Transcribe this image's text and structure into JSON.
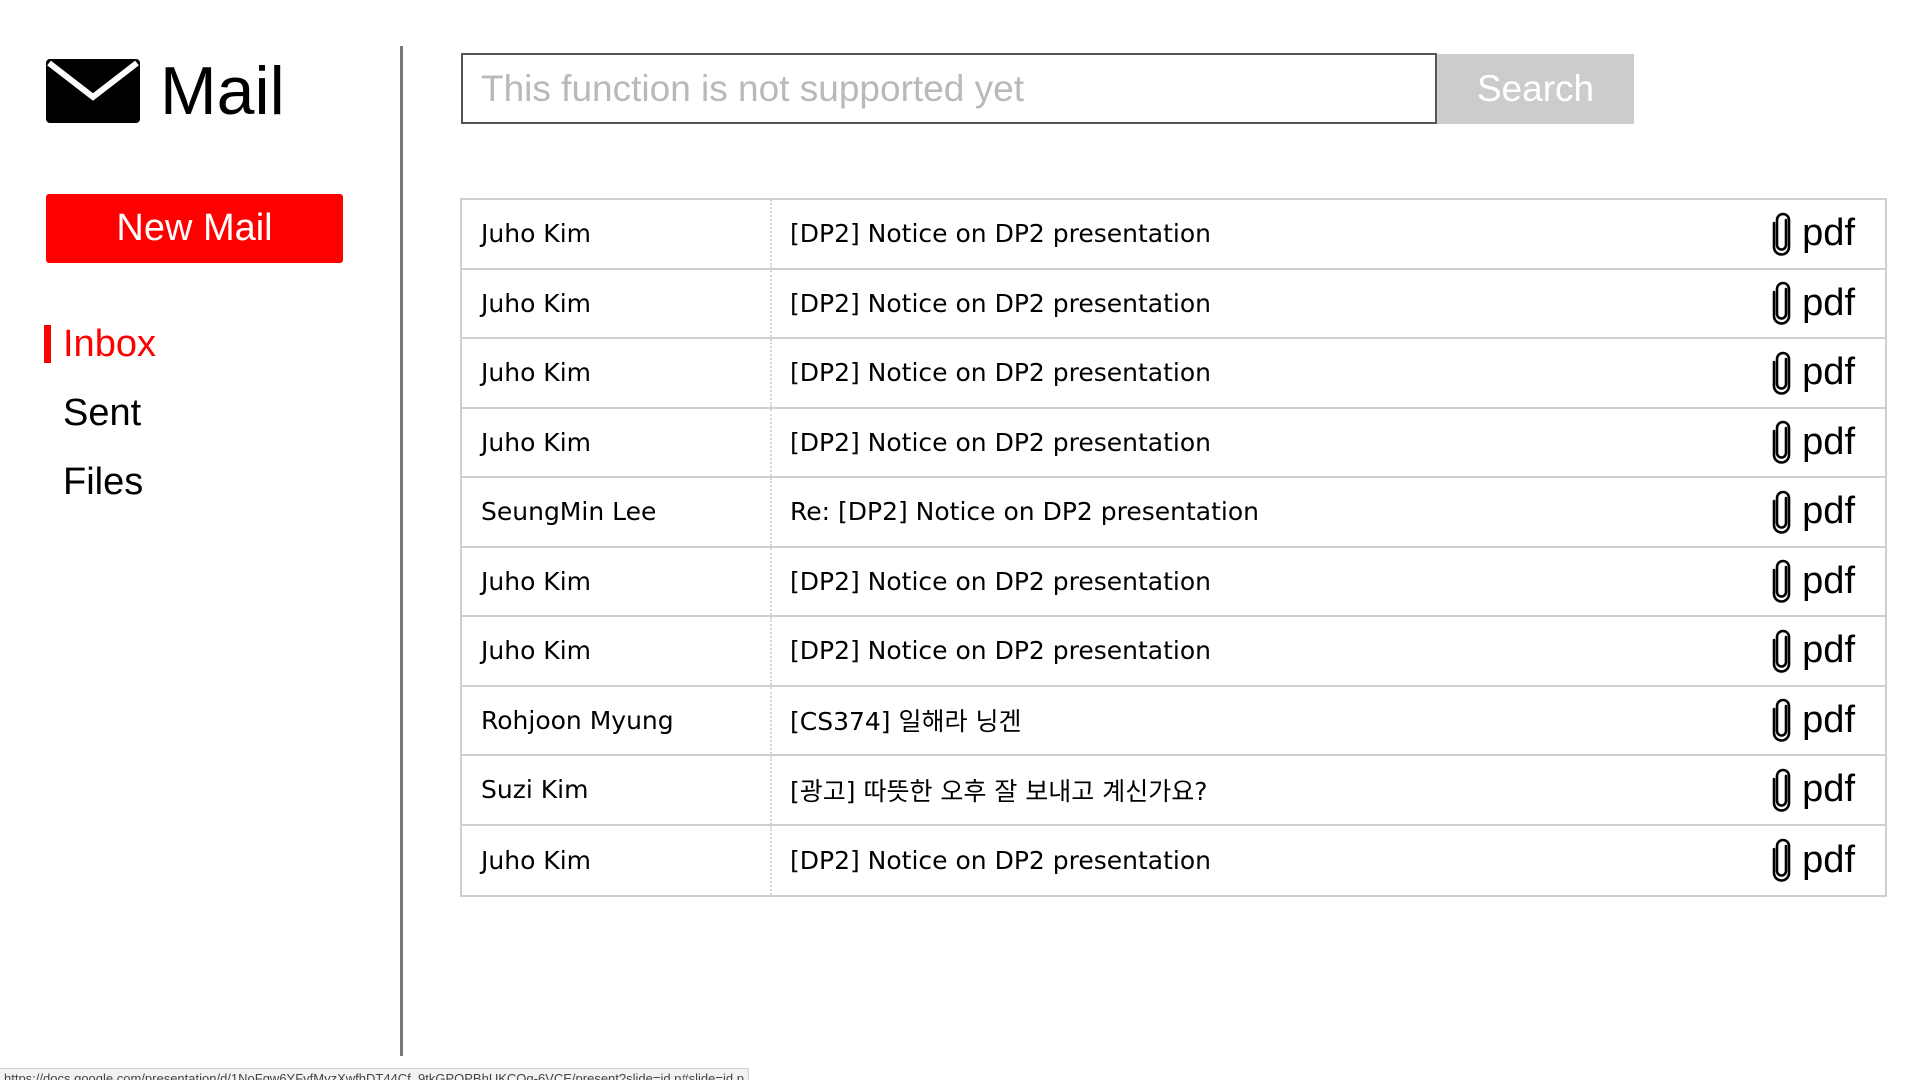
{
  "app": {
    "title": "Mail",
    "logo_icon": "envelope-icon"
  },
  "sidebar": {
    "new_mail_label": "New Mail",
    "items": [
      {
        "id": "inbox",
        "label": "Inbox",
        "active": true
      },
      {
        "id": "sent",
        "label": "Sent",
        "active": false
      },
      {
        "id": "files",
        "label": "Files",
        "active": false
      }
    ]
  },
  "search": {
    "placeholder": "This function is not supported yet",
    "value": "",
    "button_label": "Search"
  },
  "mails": [
    {
      "sender": "Juho Kim",
      "subject": "[DP2] Notice on DP2 presentation",
      "attachment": "pdf"
    },
    {
      "sender": "Juho Kim",
      "subject": "[DP2] Notice on DP2 presentation",
      "attachment": "pdf"
    },
    {
      "sender": "Juho Kim",
      "subject": "[DP2] Notice on DP2 presentation",
      "attachment": "pdf"
    },
    {
      "sender": "Juho Kim",
      "subject": "[DP2] Notice on DP2 presentation",
      "attachment": "pdf"
    },
    {
      "sender": "SeungMin Lee",
      "subject": "Re: [DP2] Notice on DP2 presentation",
      "attachment": "pdf"
    },
    {
      "sender": "Juho Kim",
      "subject": "[DP2] Notice on DP2 presentation",
      "attachment": "pdf"
    },
    {
      "sender": "Juho Kim",
      "subject": "[DP2] Notice on DP2 presentation",
      "attachment": "pdf"
    },
    {
      "sender": "Rohjoon Myung",
      "subject": "[CS374] 일해라 닝겐",
      "attachment": "pdf"
    },
    {
      "sender": "Suzi Kim",
      "subject": "[광고] 따뜻한 오후 잘 보내고 계신가요?",
      "attachment": "pdf"
    },
    {
      "sender": "Juho Kim",
      "subject": "[DP2] Notice on DP2 presentation",
      "attachment": "pdf"
    }
  ],
  "statusbar": {
    "url": "https://docs.google.com/presentation/d/1NoFqw6YFvfMyzXwfhDT44Cf_9tkGPQPBhUKCOg-6VCE/present?slide=id.p#slide=id.p"
  },
  "colors": {
    "accent": "#ff0000",
    "search_button": "#cccccc",
    "border": "#cfcfcf",
    "divider": "#777777"
  }
}
